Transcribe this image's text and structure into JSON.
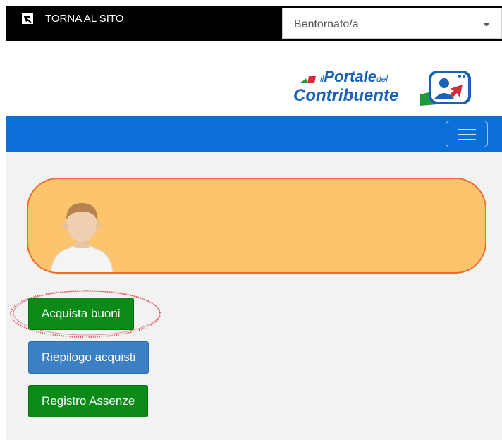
{
  "topbar": {
    "back_label": "TORNA AL SITO",
    "select_value": "Bentornato/a"
  },
  "logo": {
    "line1_prefix": "il",
    "line1_main": "Portale",
    "line1_suffix": "del",
    "line2": "Contribuente"
  },
  "actions": {
    "buy_label": "Acquista buoni",
    "summary_label": "Riepilogo acquisti",
    "absence_label": "Registro Assenze"
  },
  "colors": {
    "navbar": "#0b6fd8",
    "profile_card_bg": "#fdc46e",
    "profile_card_border": "#ec6c2c",
    "button_green": "#0b8a18",
    "button_blue": "#3b7fc4",
    "annotation_red": "#e0404a"
  },
  "icons": {
    "back": "return-arrow-icon",
    "dropdown": "chevron-down-icon",
    "menu": "hamburger-menu-icon",
    "avatar": "user-avatar-icon"
  }
}
